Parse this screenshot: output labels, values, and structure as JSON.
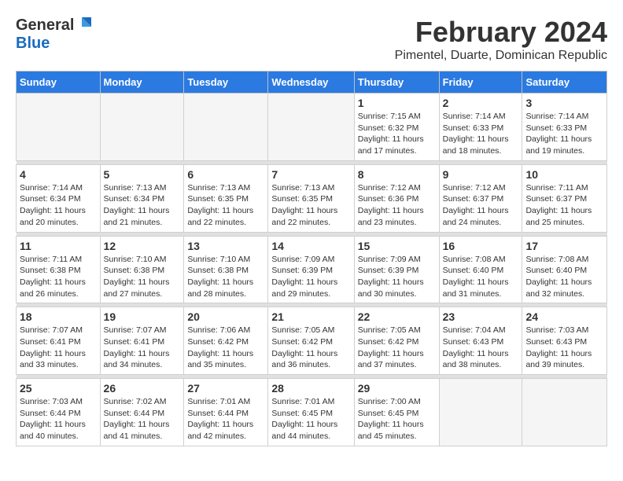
{
  "header": {
    "logo_general": "General",
    "logo_blue": "Blue",
    "month_year": "February 2024",
    "location": "Pimentel, Duarte, Dominican Republic"
  },
  "weekdays": [
    "Sunday",
    "Monday",
    "Tuesday",
    "Wednesday",
    "Thursday",
    "Friday",
    "Saturday"
  ],
  "weeks": [
    [
      {
        "day": "",
        "empty": true
      },
      {
        "day": "",
        "empty": true
      },
      {
        "day": "",
        "empty": true
      },
      {
        "day": "",
        "empty": true
      },
      {
        "day": "1",
        "sunrise": "7:15 AM",
        "sunset": "6:32 PM",
        "daylight": "11 hours and 17 minutes."
      },
      {
        "day": "2",
        "sunrise": "7:14 AM",
        "sunset": "6:33 PM",
        "daylight": "11 hours and 18 minutes."
      },
      {
        "day": "3",
        "sunrise": "7:14 AM",
        "sunset": "6:33 PM",
        "daylight": "11 hours and 19 minutes."
      }
    ],
    [
      {
        "day": "4",
        "sunrise": "7:14 AM",
        "sunset": "6:34 PM",
        "daylight": "11 hours and 20 minutes."
      },
      {
        "day": "5",
        "sunrise": "7:13 AM",
        "sunset": "6:34 PM",
        "daylight": "11 hours and 21 minutes."
      },
      {
        "day": "6",
        "sunrise": "7:13 AM",
        "sunset": "6:35 PM",
        "daylight": "11 hours and 22 minutes."
      },
      {
        "day": "7",
        "sunrise": "7:13 AM",
        "sunset": "6:35 PM",
        "daylight": "11 hours and 22 minutes."
      },
      {
        "day": "8",
        "sunrise": "7:12 AM",
        "sunset": "6:36 PM",
        "daylight": "11 hours and 23 minutes."
      },
      {
        "day": "9",
        "sunrise": "7:12 AM",
        "sunset": "6:37 PM",
        "daylight": "11 hours and 24 minutes."
      },
      {
        "day": "10",
        "sunrise": "7:11 AM",
        "sunset": "6:37 PM",
        "daylight": "11 hours and 25 minutes."
      }
    ],
    [
      {
        "day": "11",
        "sunrise": "7:11 AM",
        "sunset": "6:38 PM",
        "daylight": "11 hours and 26 minutes."
      },
      {
        "day": "12",
        "sunrise": "7:10 AM",
        "sunset": "6:38 PM",
        "daylight": "11 hours and 27 minutes."
      },
      {
        "day": "13",
        "sunrise": "7:10 AM",
        "sunset": "6:38 PM",
        "daylight": "11 hours and 28 minutes."
      },
      {
        "day": "14",
        "sunrise": "7:09 AM",
        "sunset": "6:39 PM",
        "daylight": "11 hours and 29 minutes."
      },
      {
        "day": "15",
        "sunrise": "7:09 AM",
        "sunset": "6:39 PM",
        "daylight": "11 hours and 30 minutes."
      },
      {
        "day": "16",
        "sunrise": "7:08 AM",
        "sunset": "6:40 PM",
        "daylight": "11 hours and 31 minutes."
      },
      {
        "day": "17",
        "sunrise": "7:08 AM",
        "sunset": "6:40 PM",
        "daylight": "11 hours and 32 minutes."
      }
    ],
    [
      {
        "day": "18",
        "sunrise": "7:07 AM",
        "sunset": "6:41 PM",
        "daylight": "11 hours and 33 minutes."
      },
      {
        "day": "19",
        "sunrise": "7:07 AM",
        "sunset": "6:41 PM",
        "daylight": "11 hours and 34 minutes."
      },
      {
        "day": "20",
        "sunrise": "7:06 AM",
        "sunset": "6:42 PM",
        "daylight": "11 hours and 35 minutes."
      },
      {
        "day": "21",
        "sunrise": "7:05 AM",
        "sunset": "6:42 PM",
        "daylight": "11 hours and 36 minutes."
      },
      {
        "day": "22",
        "sunrise": "7:05 AM",
        "sunset": "6:42 PM",
        "daylight": "11 hours and 37 minutes."
      },
      {
        "day": "23",
        "sunrise": "7:04 AM",
        "sunset": "6:43 PM",
        "daylight": "11 hours and 38 minutes."
      },
      {
        "day": "24",
        "sunrise": "7:03 AM",
        "sunset": "6:43 PM",
        "daylight": "11 hours and 39 minutes."
      }
    ],
    [
      {
        "day": "25",
        "sunrise": "7:03 AM",
        "sunset": "6:44 PM",
        "daylight": "11 hours and 40 minutes."
      },
      {
        "day": "26",
        "sunrise": "7:02 AM",
        "sunset": "6:44 PM",
        "daylight": "11 hours and 41 minutes."
      },
      {
        "day": "27",
        "sunrise": "7:01 AM",
        "sunset": "6:44 PM",
        "daylight": "11 hours and 42 minutes."
      },
      {
        "day": "28",
        "sunrise": "7:01 AM",
        "sunset": "6:45 PM",
        "daylight": "11 hours and 44 minutes."
      },
      {
        "day": "29",
        "sunrise": "7:00 AM",
        "sunset": "6:45 PM",
        "daylight": "11 hours and 45 minutes."
      },
      {
        "day": "",
        "empty": true
      },
      {
        "day": "",
        "empty": true
      }
    ]
  ]
}
